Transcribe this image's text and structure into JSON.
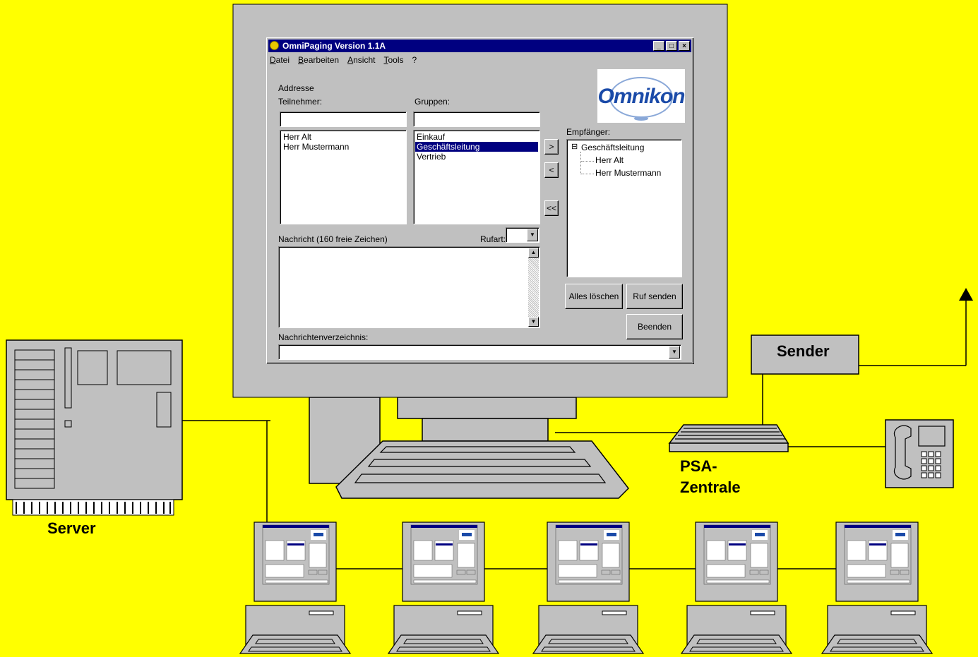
{
  "labels": {
    "server": "Server",
    "sender": "Sender",
    "psa_line1": "PSA-",
    "psa_line2": "Zentrale"
  },
  "app": {
    "title": "OmniPaging Version 1.1A",
    "window_buttons": [
      "_",
      "□",
      "×"
    ],
    "menu": [
      "Datei",
      "Bearbeiten",
      "Ansicht",
      "Tools",
      "?"
    ],
    "logo_text": "Omnikon",
    "address_label": "Addresse",
    "participants_label": "Teilnehmer:",
    "groups_label": "Gruppen:",
    "participants": [
      "Herr Alt",
      "Herr Mustermann"
    ],
    "groups": [
      {
        "label": "Einkauf",
        "selected": false
      },
      {
        "label": "Geschäftsleitung",
        "selected": true
      },
      {
        "label": "Vertrieb",
        "selected": false
      }
    ],
    "move_buttons": [
      ">",
      "<",
      "<<"
    ],
    "recipients_label": "Empfänger:",
    "recipients_root": "Geschäftsleitung",
    "recipients_children": [
      "Herr Alt",
      "Herr Mustermann"
    ],
    "tree_toggle": "⊟",
    "message_label": "Nachricht (160 freie Zeichen)",
    "call_type_label": "Rufart:",
    "directory_label": "Nachrichtenverzeichnis:",
    "clear_all_button": "Alles löschen",
    "send_button": "Ruf senden",
    "exit_button": "Beenden"
  },
  "colors": {
    "background": "#ffff00",
    "device_fill": "#c0c0c0",
    "titlebar": "#000080",
    "logo_blue": "#1a4aa8"
  }
}
